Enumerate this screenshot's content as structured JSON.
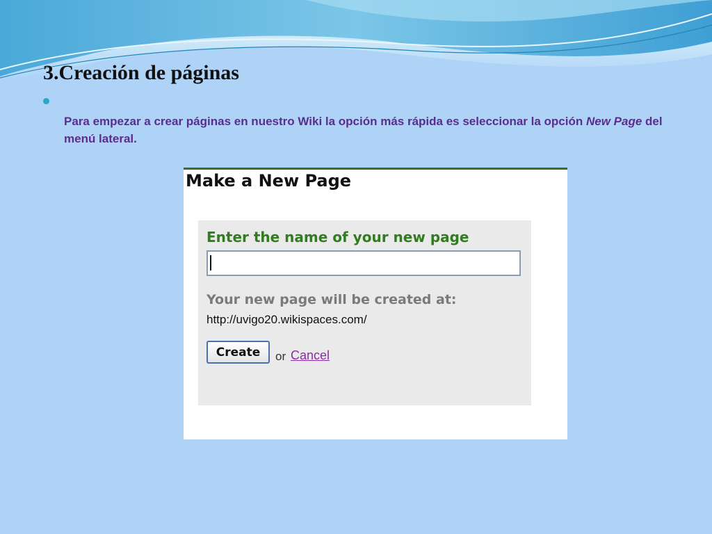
{
  "slide": {
    "title": "3.Creación de páginas",
    "body_pre": "Para empezar a crear páginas en nuestro Wiki la opción más rápida es seleccionar la opción ",
    "body_em": "New Page",
    "body_post": " del menú lateral."
  },
  "dialog": {
    "title": "Make a New Page",
    "form_heading": "Enter the name of your new page",
    "input_value": "",
    "created_at_label": "Your new page will be created at:",
    "url": "http://uvigo20.wikispaces.com/",
    "create_label": "Create",
    "or_text": "or",
    "cancel_label": "Cancel"
  },
  "colors": {
    "background": "#aed3f7",
    "body_text": "#5b2d8c",
    "form_heading": "#2f7d1f",
    "cancel_link": "#8a2da6",
    "bullet": "#2aa7c9"
  }
}
